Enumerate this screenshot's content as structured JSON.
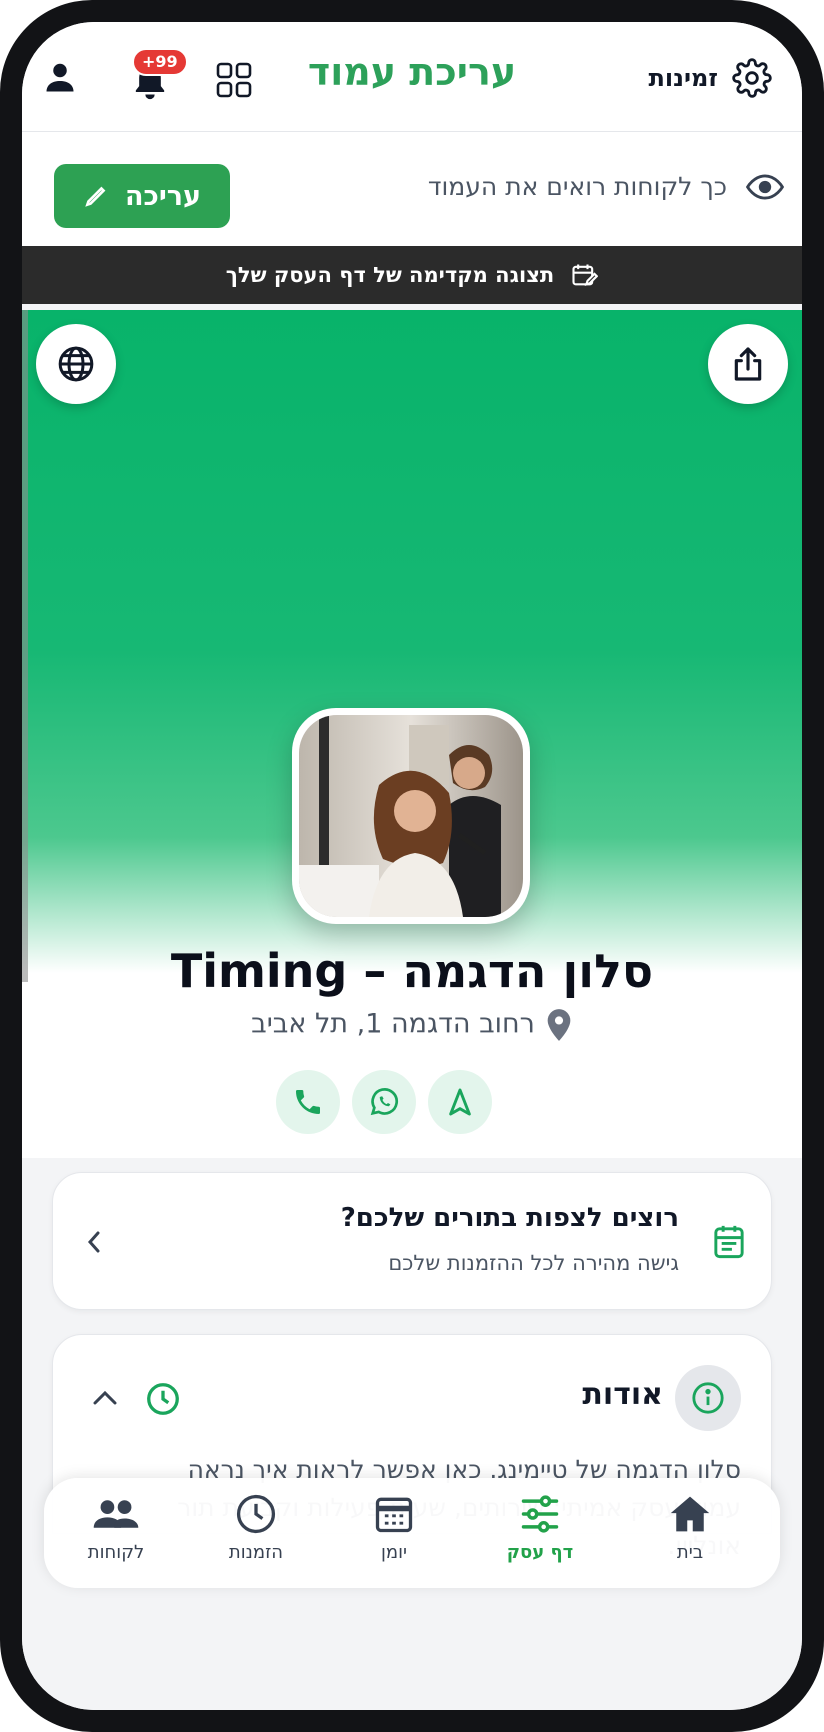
{
  "header": {
    "title": "עריכת עמוד",
    "bookings_label": "זמינות",
    "notification_badge": "+99"
  },
  "preview": {
    "text": "כך לקוחות רואים את העמוד",
    "edit_label": "עריכה"
  },
  "banner": {
    "text": "תצוגה מקדימה של דף העסק שלך"
  },
  "business": {
    "name": "סלון הדגמה – Timing",
    "address": "רחוב הדגמה 1, תל אביב"
  },
  "bookings_card": {
    "title": "רוצים לצפות בתורים שלכם?",
    "subtitle": "גישה מהירה לכל ההזמנות שלכם"
  },
  "about": {
    "title": "אודות",
    "text": "סלון הדגמה של טיימינג. כאן אפשר לראות איך נראה עמוד עסק אמיתי: שירותים, שעות פעילות וקביעת תור אונליין."
  },
  "nav": {
    "items": [
      {
        "label": "בית",
        "icon": "home-icon"
      },
      {
        "label": "דף עסק",
        "icon": "sliders-icon",
        "active": true
      },
      {
        "label": "יומן",
        "icon": "calendar-icon"
      },
      {
        "label": "הזמנות",
        "icon": "clock-icon"
      },
      {
        "label": "לקוחות",
        "icon": "users-icon"
      }
    ]
  },
  "colors": {
    "brand_green": "#2da15a",
    "hero_green": "#08b36a",
    "badge_red": "#e53935",
    "dark_banner": "#2b2b2b"
  }
}
